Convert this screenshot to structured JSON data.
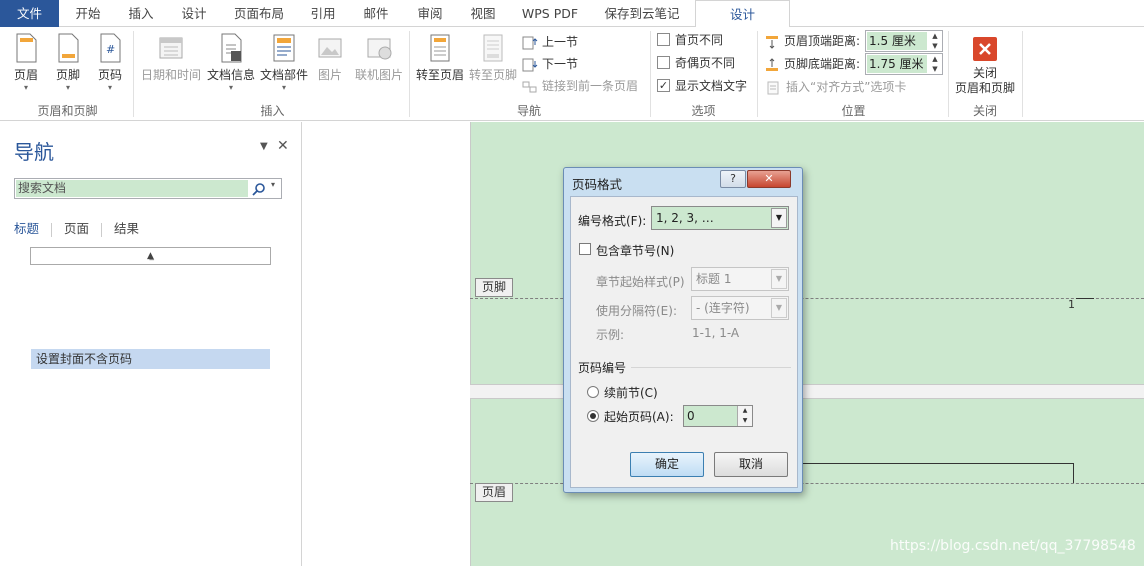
{
  "tabs": {
    "file": "文件",
    "home": "开始",
    "insert": "插入",
    "design": "设计",
    "layout": "页面布局",
    "references": "引用",
    "mailings": "邮件",
    "review": "审阅",
    "view": "视图",
    "wpspdf": "WPS PDF",
    "cloud": "保存到云笔记",
    "active_design": "设计"
  },
  "ribbon": {
    "header_footer": {
      "header": "页眉",
      "footer": "页脚",
      "page_number": "页码",
      "label": "页眉和页脚"
    },
    "insert": {
      "date_time": "日期和时间",
      "doc_info": "文档信息",
      "doc_parts": "文档部件",
      "picture": "图片",
      "online_picture": "联机图片",
      "label": "插入"
    },
    "navigation": {
      "goto_header": "转至页眉",
      "goto_footer": "转至页脚",
      "prev_section": "上一节",
      "next_section": "下一节",
      "link_previous": "链接到前一条页眉",
      "label": "导航"
    },
    "options": {
      "different_first": "首页不同",
      "different_odd_even": "奇偶页不同",
      "show_doc_text": "显示文档文字",
      "label": "选项"
    },
    "position": {
      "header_top_label": "页眉顶端距离:",
      "header_top_value": "1.5 厘米",
      "footer_bottom_label": "页脚底端距离:",
      "footer_bottom_value": "1.75 厘米",
      "insert_align_tab": "插入“对齐方式”选项卡",
      "label": "位置"
    },
    "close": {
      "close_btn_line1": "关闭",
      "close_btn_line2": "页眉和页脚",
      "label": "关闭"
    }
  },
  "nav": {
    "title": "导航",
    "search_placeholder": "搜索文档",
    "tab_headings": "标题",
    "tab_pages": "页面",
    "tab_results": "结果",
    "heading_item": "设置封面不含页码"
  },
  "document": {
    "footer_tag": "页脚",
    "header_tag": "页眉",
    "page_number": "1",
    "watermark": "https://blog.csdn.net/qq_37798548"
  },
  "dialog": {
    "title": "页码格式",
    "help": "?",
    "close": "✕",
    "number_format_label": "编号格式(F):",
    "number_format_value": "1, 2, 3, …",
    "include_chapter_label": "包含章节号(N)",
    "chapter_start_label": "章节起始样式(P)",
    "chapter_start_value": "标题 1",
    "separator_label": "使用分隔符(E):",
    "separator_value": "-  (连字符)",
    "example_label": "示例:",
    "example_value": "1-1, 1-A",
    "page_numbering_label": "页码编号",
    "continue_label": "续前节(C)",
    "start_at_label": "起始页码(A):",
    "start_at_value": "0",
    "ok": "确定",
    "cancel": "取消"
  }
}
